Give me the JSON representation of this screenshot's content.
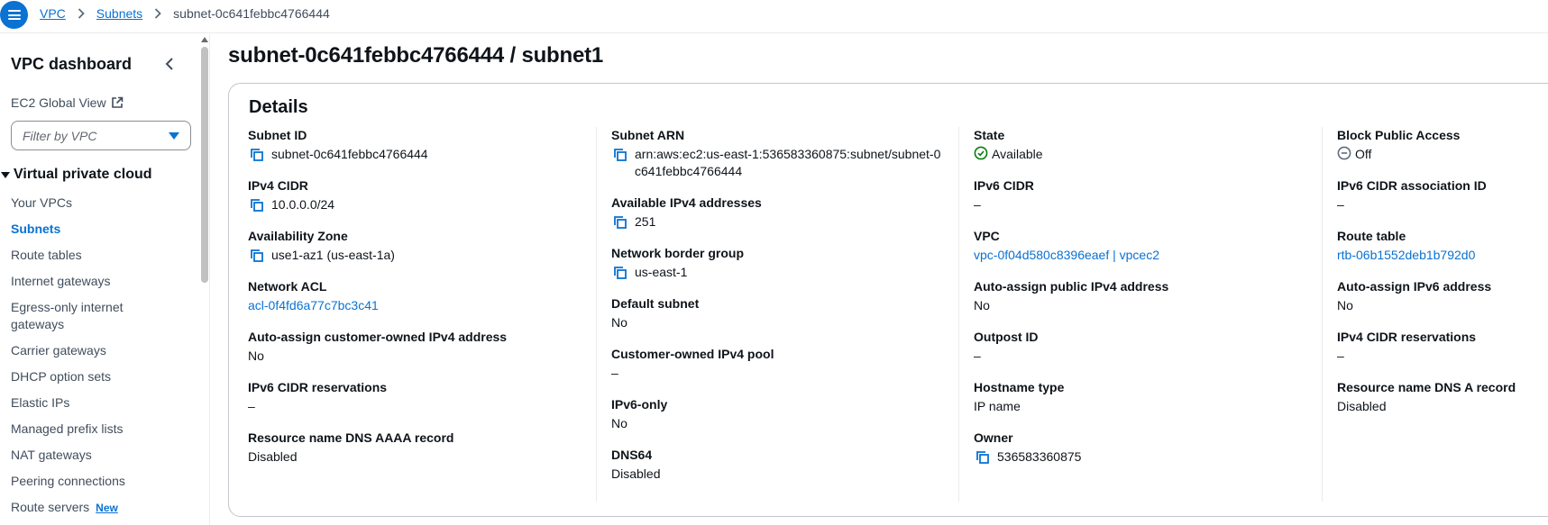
{
  "breadcrumb": {
    "items": [
      "VPC",
      "Subnets"
    ],
    "current": "subnet-0c641febbc4766444"
  },
  "sidebar": {
    "title": "VPC dashboard",
    "global_view": "EC2 Global View",
    "filter_placeholder": "Filter by VPC",
    "section": "Virtual private cloud",
    "items": [
      {
        "label": "Your VPCs"
      },
      {
        "label": "Subnets",
        "active": true
      },
      {
        "label": "Route tables"
      },
      {
        "label": "Internet gateways"
      },
      {
        "label": "Egress-only internet gateways"
      },
      {
        "label": "Carrier gateways"
      },
      {
        "label": "DHCP option sets"
      },
      {
        "label": "Elastic IPs"
      },
      {
        "label": "Managed prefix lists"
      },
      {
        "label": "NAT gateways"
      },
      {
        "label": "Peering connections"
      },
      {
        "label": "Route servers",
        "badge": "New"
      }
    ]
  },
  "page": {
    "title": "subnet-0c641febbc4766444 / subnet1"
  },
  "details": {
    "title": "Details",
    "col1": {
      "subnet_id": {
        "label": "Subnet ID",
        "value": "subnet-0c641febbc4766444"
      },
      "ipv4_cidr": {
        "label": "IPv4 CIDR",
        "value": "10.0.0.0/24"
      },
      "az": {
        "label": "Availability Zone",
        "value": "use1-az1 (us-east-1a)"
      },
      "nacl": {
        "label": "Network ACL",
        "value": "acl-0f4fd6a77c7bc3c41"
      },
      "auto_cust_ipv4": {
        "label": "Auto-assign customer-owned IPv4 address",
        "value": "No"
      },
      "ipv6_cidr_res": {
        "label": "IPv6 CIDR reservations",
        "value": "–"
      },
      "dns_aaaa": {
        "label": "Resource name DNS AAAA record",
        "value": "Disabled"
      }
    },
    "col2": {
      "arn": {
        "label": "Subnet ARN",
        "value": "arn:aws:ec2:us-east-1:536583360875:subnet/subnet-0c641febbc4766444"
      },
      "avail_ipv4": {
        "label": "Available IPv4 addresses",
        "value": "251"
      },
      "nbg": {
        "label": "Network border group",
        "value": "us-east-1"
      },
      "default_subnet": {
        "label": "Default subnet",
        "value": "No"
      },
      "cust_pool": {
        "label": "Customer-owned IPv4 pool",
        "value": "–"
      },
      "ipv6_only": {
        "label": "IPv6-only",
        "value": "No"
      },
      "dns64": {
        "label": "DNS64",
        "value": "Disabled"
      }
    },
    "col3": {
      "state": {
        "label": "State",
        "value": "Available"
      },
      "ipv6_cidr": {
        "label": "IPv6 CIDR",
        "value": "–"
      },
      "vpc": {
        "label": "VPC",
        "value": "vpc-0f04d580c8396eaef | vpcec2"
      },
      "auto_pub_ipv4": {
        "label": "Auto-assign public IPv4 address",
        "value": "No"
      },
      "outpost": {
        "label": "Outpost ID",
        "value": "–"
      },
      "hostname": {
        "label": "Hostname type",
        "value": "IP name"
      },
      "owner": {
        "label": "Owner",
        "value": "536583360875"
      }
    },
    "col4": {
      "bpa": {
        "label": "Block Public Access",
        "value": "Off"
      },
      "ipv6_assoc": {
        "label": "IPv6 CIDR association ID",
        "value": "–"
      },
      "route_table": {
        "label": "Route table",
        "value": "rtb-06b1552deb1b792d0"
      },
      "auto_ipv6": {
        "label": "Auto-assign IPv6 address",
        "value": "No"
      },
      "ipv4_res": {
        "label": "IPv4 CIDR reservations",
        "value": "–"
      },
      "dns_a": {
        "label": "Resource name DNS A record",
        "value": "Disabled"
      }
    }
  },
  "colors": {
    "link": "#0972d3",
    "success": "#037f0c",
    "text": "#0f141a",
    "muted": "#5f6b7a"
  },
  "icons": [
    "menu-icon",
    "chevron-right-icon",
    "chevron-left-icon",
    "external-link-icon",
    "caret-down-icon",
    "copy-icon",
    "status-success-icon",
    "status-off-icon"
  ]
}
